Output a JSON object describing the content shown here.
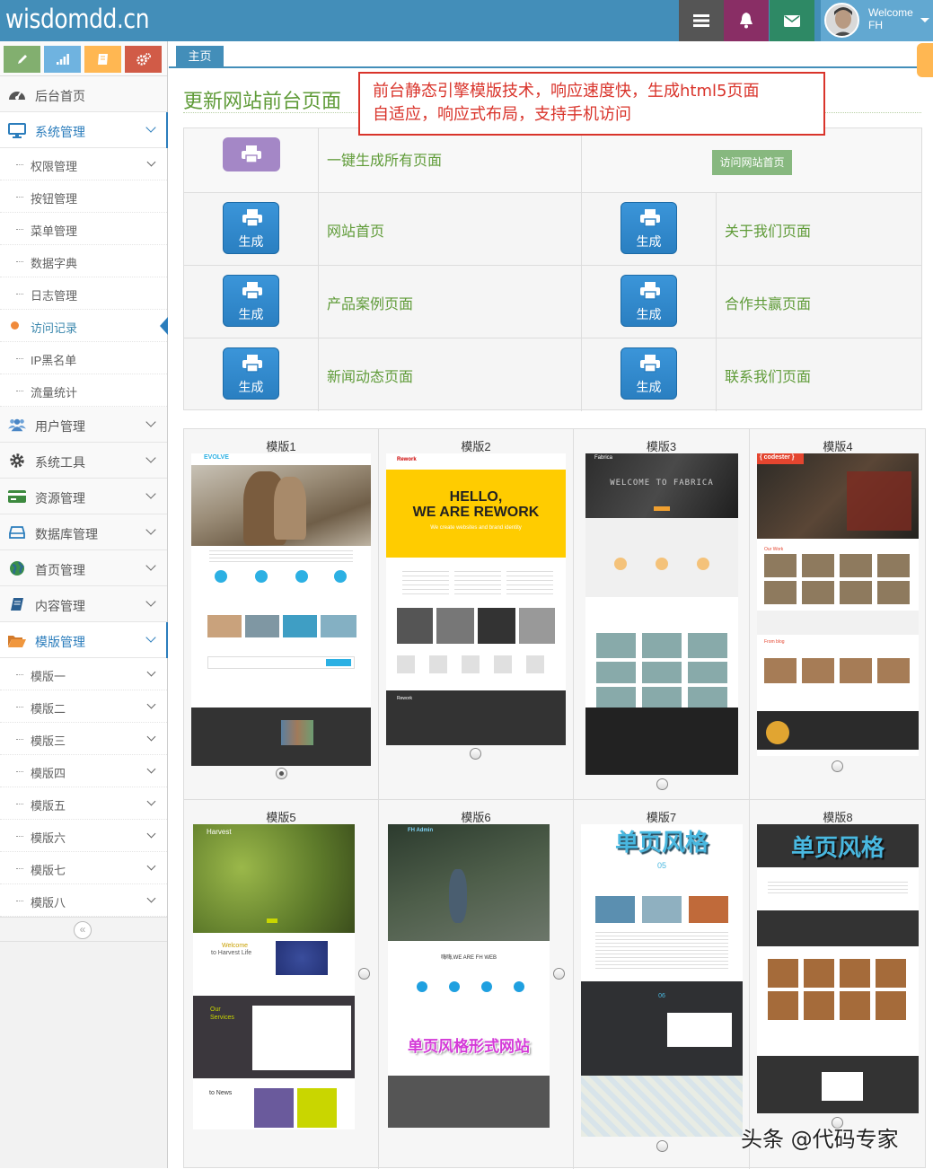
{
  "brand": "wisdomdd.cn",
  "navbar": {
    "tasks_icon": "tasks-icon",
    "bell_icon": "bell-icon",
    "mail_icon": "envelope-icon",
    "colors": {
      "bar": "#438eb9",
      "tasks": "#555555",
      "bell": "#892e65",
      "mail": "#2e8965",
      "user": "#62a8d1"
    },
    "user": {
      "welcome": "Welcome",
      "name": "FH"
    }
  },
  "sidebar": {
    "shortcuts": [
      {
        "icon": "pencil-icon",
        "color": "#82af6f"
      },
      {
        "icon": "signal-icon",
        "color": "#6fb3e0"
      },
      {
        "icon": "book-icon",
        "color": "#ffb752"
      },
      {
        "icon": "cogs-icon",
        "color": "#d15b47"
      }
    ],
    "home": "后台首页",
    "system": "系统管理",
    "system_items": [
      "权限管理",
      "按钮管理",
      "菜单管理",
      "数据字典",
      "日志管理",
      "访问记录",
      "IP黑名单",
      "流量统计"
    ],
    "menus": [
      "用户管理",
      "系统工具",
      "资源管理",
      "数据库管理",
      "首页管理",
      "内容管理"
    ],
    "templates": "模版管理",
    "template_items": [
      "模版一",
      "模版二",
      "模版三",
      "模版四",
      "模版五",
      "模版六",
      "模版七",
      "模版八"
    ],
    "collapse": "«"
  },
  "breadcrumb": {
    "home": "主页"
  },
  "page": {
    "title": "更新网站前台页面",
    "annotation_line1": "前台静态引擎模版技术，响应速度快，生成html5页面",
    "annotation_line2": "自适应，响应式布局，支持手机访问"
  },
  "generate": {
    "all_label": "一键生成所有页面",
    "visit_button": "访问网站首页",
    "button_label": "生成",
    "pages": [
      "网站首页",
      "关于我们页面",
      "产品案例页面",
      "合作共赢页面",
      "新闻动态页面",
      "联系我们页面"
    ]
  },
  "templates": {
    "names": [
      "模版1",
      "模版2",
      "模版3",
      "模版4",
      "模版5",
      "模版6",
      "模版7",
      "模版8"
    ],
    "selected_index": 0,
    "t1": {
      "brand": "EVOLVE"
    },
    "t2": {
      "brand": "Rework",
      "hero1": "HELLO,",
      "hero2": "WE ARE REWORK",
      "sub": "We create websites and brand identity"
    },
    "t3": {
      "brand": "Fabrica",
      "hero": "WELCOME TO FABRICA"
    },
    "t4": {
      "brand": "{ codester }",
      "section1": "Our Work",
      "section2": "From blog"
    },
    "t5": {
      "brand": "Harvest",
      "welcome": "Welcome",
      "welcome_sub": "to Harvest Life",
      "services": "Our Services",
      "news": "to News"
    },
    "t6": {
      "brand": "FH Admin",
      "heading": "嗨嗨,WE ARE FH WEB",
      "overlay": "单页风格形式网站"
    },
    "t7": {
      "overlay": "单页风格",
      "num": "05",
      "num2": "06"
    },
    "t8": {
      "overlay": "单页风格"
    }
  },
  "watermark": "头条 @代码专家"
}
